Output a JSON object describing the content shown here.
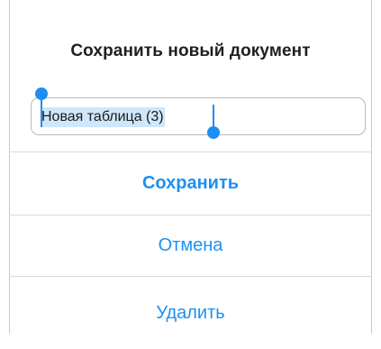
{
  "dialog": {
    "title": "Сохранить новый документ",
    "filename_value": "Новая таблица (3)",
    "actions": {
      "save_label": "Сохранить",
      "cancel_label": "Отмена",
      "delete_label": "Удалить"
    }
  },
  "colors": {
    "accent": "#1e90f2",
    "selection": "#cfe6fb",
    "selection_handle": "#1f8ef1",
    "title_text": "#1f1f1f",
    "divider": "#dcdcdc"
  }
}
